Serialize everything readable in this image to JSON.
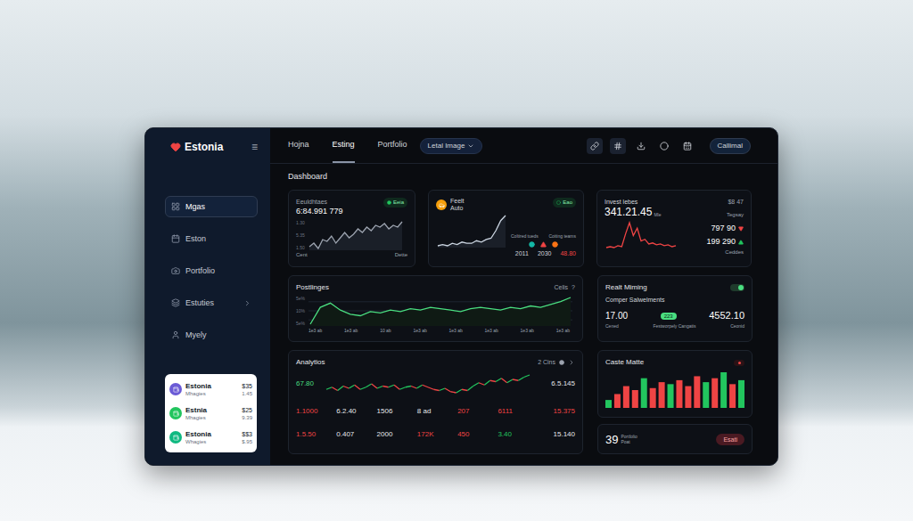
{
  "topbar": {
    "tabs": [
      {
        "label": "Hojna",
        "selected": false
      },
      {
        "label": "Esting",
        "selected": true
      },
      {
        "label": "Portfolio",
        "selected": false
      }
    ],
    "dropdown": {
      "label": "Letal Image"
    },
    "button": "Callimal"
  },
  "sidebar": {
    "logo": "Estonia",
    "menu_glyph": "≡",
    "items": [
      {
        "label": "Mgas",
        "selected": true,
        "expandable": false
      },
      {
        "label": "Eston",
        "selected": false,
        "expandable": false
      },
      {
        "label": "Portfolio",
        "selected": false,
        "expandable": false
      },
      {
        "label": "Estuties",
        "selected": false,
        "expandable": true
      },
      {
        "label": "Myely",
        "selected": false,
        "expandable": false
      }
    ],
    "accounts": [
      {
        "name": "Estonia",
        "sub": "Mhagies",
        "amount": "$35",
        "change": "1.45",
        "color": "#6b5bd6"
      },
      {
        "name": "Estnia",
        "sub": "Mhagies",
        "amount": "$25",
        "change": "9.39",
        "color": "#22c55e"
      },
      {
        "name": "Estonia",
        "sub": "Whagies",
        "amount": "$$3",
        "change": "$.95",
        "color": "#10b981"
      }
    ]
  },
  "page_title": "Dashboard",
  "balance_card": {
    "title": "Eeuldhtaes",
    "value": "6:84.991 779",
    "badge": "Eeia",
    "y_ticks": [
      "1.30",
      "5.35",
      "1.50"
    ],
    "x_labels": [
      "Cent",
      "Dette"
    ],
    "series": [
      22,
      24,
      21,
      26,
      25,
      28,
      24,
      27,
      30,
      27,
      29,
      32,
      30,
      33,
      31,
      34,
      33,
      35,
      32,
      34,
      33,
      36
    ]
  },
  "auto_card": {
    "title": "Feelt",
    "subtitle": "Auto",
    "badge": "Eao",
    "legend": [
      "Coltired tueds",
      "Coiting teams"
    ],
    "footer": [
      {
        "text": "2011",
        "color": "#d1d5db"
      },
      {
        "text": "2030",
        "color": "#d1d5db"
      },
      {
        "text": "48.80",
        "color": "#ef4444"
      }
    ],
    "series": [
      10,
      11,
      10,
      12,
      11,
      13,
      12,
      12,
      14,
      13,
      15,
      16,
      22,
      30,
      34
    ]
  },
  "invest_card": {
    "title": "Invest lebes",
    "corner": "$8 47",
    "value": "341.21.45",
    "unit": "Mle",
    "label": "Tegsay",
    "stats": [
      {
        "value": "797 90",
        "trend": "down",
        "color": "#ef4444"
      },
      {
        "value": "199 290",
        "trend": "up",
        "color": "#22c55e"
      }
    ],
    "footer": "Ceddes",
    "series": [
      5,
      6,
      5,
      7,
      6,
      20,
      32,
      18,
      26,
      12,
      14,
      9,
      10,
      8,
      9,
      7,
      8,
      6,
      7
    ]
  },
  "trends_card": {
    "title": "Postlinges",
    "action": "Celis",
    "help": "?",
    "y_ticks": [
      "5e%",
      "10%",
      "5e%"
    ],
    "x_labels": [
      "1e3 ab",
      "1e3 ab",
      "10 ab",
      "1e3 ab",
      "1e3 ab",
      "1e3 ab",
      "1e3 ab",
      "1e3 ab"
    ],
    "series": [
      18,
      30,
      33,
      28,
      25,
      24,
      27,
      26,
      28,
      27,
      29,
      28,
      30,
      29,
      28,
      27,
      29,
      30,
      29,
      28,
      30,
      29,
      31,
      30,
      32,
      34,
      37
    ]
  },
  "realtime_card": {
    "title": "Realt Miming",
    "toggle_on": true,
    "subtitle": "Comper Salwelments",
    "left_value": "17.00",
    "badge": "223",
    "right_value": "4552.10",
    "captions": [
      "Cened",
      "Festworpely Cangatis",
      "Ceonid"
    ]
  },
  "analytics_card": {
    "title": "Analytios",
    "action": "2 Cins",
    "price_left": "67.80",
    "price_right": "6.5.145",
    "series": [
      20,
      22,
      19,
      23,
      21,
      24,
      20,
      22,
      25,
      21,
      23,
      22,
      24,
      20,
      22,
      23,
      21,
      24,
      22,
      20,
      19,
      21,
      18,
      17,
      20,
      19,
      23,
      26,
      24,
      28,
      27,
      30,
      26,
      29,
      28,
      31,
      33
    ],
    "rows": [
      [
        {
          "text": "1.1000",
          "color": "#ef4444"
        },
        {
          "text": "6.2.40",
          "color": "#e5e7eb"
        },
        {
          "text": "1506",
          "color": "#e5e7eb"
        },
        {
          "text": "8 ad",
          "color": "#e5e7eb"
        },
        {
          "text": "207",
          "color": "#ef4444"
        },
        {
          "text": "6111",
          "color": "#ef4444"
        },
        {
          "text": "15.375",
          "color": "#ef4444"
        }
      ],
      [
        {
          "text": "1.5.50",
          "color": "#ef4444"
        },
        {
          "text": "0.407",
          "color": "#e5e7eb"
        },
        {
          "text": "2000",
          "color": "#e5e7eb"
        },
        {
          "text": "172K",
          "color": "#ef4444"
        },
        {
          "text": "450",
          "color": "#ef4444"
        },
        {
          "text": "3.40",
          "color": "#22c55e"
        },
        {
          "text": "15.140",
          "color": "#e5e7eb"
        }
      ]
    ]
  },
  "cash_card": {
    "title": "Caste Matte",
    "bars": [
      {
        "value": 8,
        "color": "#22c55e"
      },
      {
        "value": 14,
        "color": "#ef4444"
      },
      {
        "value": 22,
        "color": "#ef4444"
      },
      {
        "value": 18,
        "color": "#ef4444"
      },
      {
        "value": 30,
        "color": "#22c55e"
      },
      {
        "value": 20,
        "color": "#ef4444"
      },
      {
        "value": 26,
        "color": "#ef4444"
      },
      {
        "value": 24,
        "color": "#22c55e"
      },
      {
        "value": 28,
        "color": "#ef4444"
      },
      {
        "value": 22,
        "color": "#ef4444"
      },
      {
        "value": 32,
        "color": "#ef4444"
      },
      {
        "value": 26,
        "color": "#22c55e"
      },
      {
        "value": 30,
        "color": "#ef4444"
      },
      {
        "value": 36,
        "color": "#22c55e"
      },
      {
        "value": 24,
        "color": "#ef4444"
      },
      {
        "value": 28,
        "color": "#22c55e"
      }
    ]
  },
  "portfolio_card": {
    "value": "39",
    "label": "Portfolio",
    "sub": "Poat",
    "button": "Esati"
  }
}
